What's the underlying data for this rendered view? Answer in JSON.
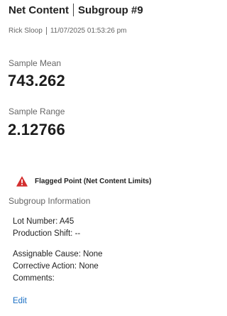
{
  "header": {
    "title": "Net Content",
    "subgroup": "Subgroup #9",
    "user": "Rick Sloop",
    "timestamp": "11/07/2025 01:53:26 pm"
  },
  "stats": {
    "mean_label": "Sample Mean",
    "mean_value": "743.262",
    "range_label": "Sample Range",
    "range_value": "2.12766"
  },
  "flag": {
    "icon": "warning-triangle-icon",
    "icon_color": "#d32f2f",
    "text": "Flagged Point (Net Content Limits)"
  },
  "subgroup_info": {
    "title": "Subgroup Information",
    "lot_number": "Lot Number: A45",
    "production_shift": "Production Shift: --",
    "assignable_cause": "Assignable Cause: None",
    "corrective_action": "Corrective Action: None",
    "comments": "Comments:"
  },
  "actions": {
    "edit_label": "Edit"
  }
}
